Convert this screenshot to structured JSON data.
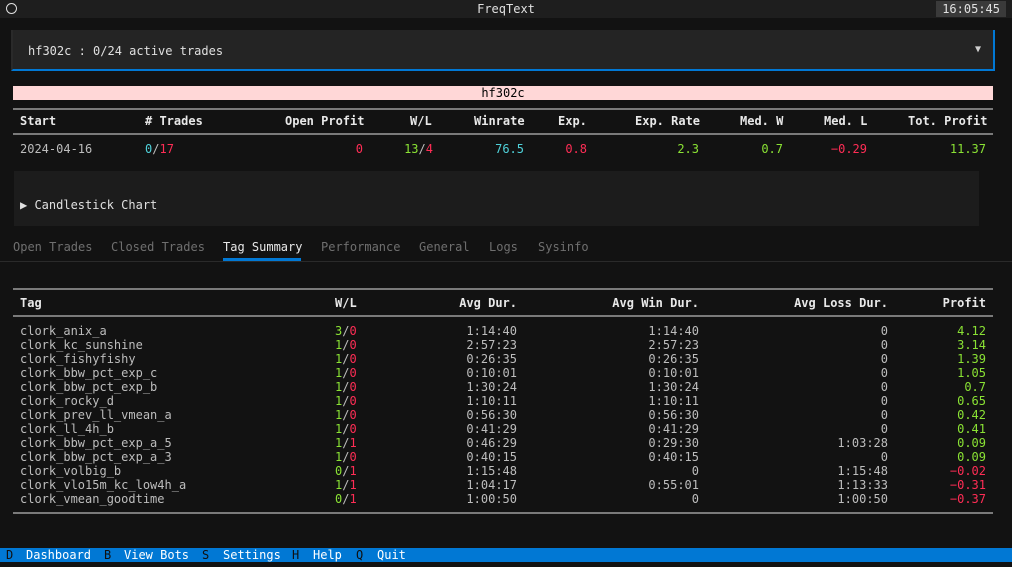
{
  "window": {
    "title": "FreqText",
    "clock": "16:05:45"
  },
  "bot_selector": {
    "label": "hf302c : 0/24 active trades"
  },
  "bot_name": "hf302c",
  "summary": {
    "headers": [
      "Start",
      "# Trades",
      "Open Profit",
      "W/L",
      "Winrate",
      "Exp.",
      "Exp. Rate",
      "Med. W",
      "Med. L",
      "Tot. Profit"
    ],
    "row": {
      "start": "2024-04-16",
      "trades_open": "0",
      "trades_sep": "/",
      "trades_total": "17",
      "open_profit": "0",
      "wins": "13",
      "wl_sep": "/",
      "losses": "4",
      "winrate": "76.5",
      "exp": "0.8",
      "exp_rate": "2.3",
      "med_w": "0.7",
      "med_l": "−0.29",
      "tot_profit": "11.37"
    }
  },
  "candlestick": {
    "label": "▶ Candlestick Chart"
  },
  "tabs": [
    {
      "label": "Open Trades",
      "active": false
    },
    {
      "label": "Closed Trades",
      "active": false
    },
    {
      "label": "Tag Summary",
      "active": true
    },
    {
      "label": "Performance",
      "active": false
    },
    {
      "label": "General",
      "active": false
    },
    {
      "label": "Logs",
      "active": false
    },
    {
      "label": "Sysinfo",
      "active": false
    }
  ],
  "tag_summary": {
    "headers": [
      "Tag",
      "W/L",
      "Avg Dur.",
      "Avg Win Dur.",
      "Avg Loss Dur.",
      "Profit"
    ],
    "rows": [
      {
        "tag": "clork_anix_a",
        "w": "3",
        "l": "0",
        "avg": "1:14:40",
        "win": "1:14:40",
        "loss": "0",
        "profit": "4.12"
      },
      {
        "tag": "clork_kc_sunshine",
        "w": "1",
        "l": "0",
        "avg": "2:57:23",
        "win": "2:57:23",
        "loss": "0",
        "profit": "3.14"
      },
      {
        "tag": "clork_fishyfishy",
        "w": "1",
        "l": "0",
        "avg": "0:26:35",
        "win": "0:26:35",
        "loss": "0",
        "profit": "1.39"
      },
      {
        "tag": "clork_bbw_pct_exp_c",
        "w": "1",
        "l": "0",
        "avg": "0:10:01",
        "win": "0:10:01",
        "loss": "0",
        "profit": "1.05"
      },
      {
        "tag": "clork_bbw_pct_exp_b",
        "w": "1",
        "l": "0",
        "avg": "1:30:24",
        "win": "1:30:24",
        "loss": "0",
        "profit": "0.7"
      },
      {
        "tag": "clork_rocky_d",
        "w": "1",
        "l": "0",
        "avg": "1:10:11",
        "win": "1:10:11",
        "loss": "0",
        "profit": "0.65"
      },
      {
        "tag": "clork_prev_ll_vmean_a",
        "w": "1",
        "l": "0",
        "avg": "0:56:30",
        "win": "0:56:30",
        "loss": "0",
        "profit": "0.42"
      },
      {
        "tag": "clork_ll_4h_b",
        "w": "1",
        "l": "0",
        "avg": "0:41:29",
        "win": "0:41:29",
        "loss": "0",
        "profit": "0.41"
      },
      {
        "tag": "clork_bbw_pct_exp_a_5",
        "w": "1",
        "l": "1",
        "avg": "0:46:29",
        "win": "0:29:30",
        "loss": "1:03:28",
        "profit": "0.09"
      },
      {
        "tag": "clork_bbw_pct_exp_a_3",
        "w": "1",
        "l": "0",
        "avg": "0:40:15",
        "win": "0:40:15",
        "loss": "0",
        "profit": "0.09"
      },
      {
        "tag": "clork_volbig_b",
        "w": "0",
        "l": "1",
        "avg": "1:15:48",
        "win": "0",
        "loss": "1:15:48",
        "profit": "−0.02"
      },
      {
        "tag": "clork_vlo15m_kc_low4h_a",
        "w": "1",
        "l": "1",
        "avg": "1:04:17",
        "win": "0:55:01",
        "loss": "1:13:33",
        "profit": "−0.31"
      },
      {
        "tag": "clork_vmean_goodtime",
        "w": "0",
        "l": "1",
        "avg": "1:00:50",
        "win": "0",
        "loss": "1:00:50",
        "profit": "−0.37"
      }
    ]
  },
  "footer": [
    {
      "key": "D",
      "label": "Dashboard"
    },
    {
      "key": "B",
      "label": "View Bots"
    },
    {
      "key": "S",
      "label": "Settings"
    },
    {
      "key": "H",
      "label": "Help"
    },
    {
      "key": "Q",
      "label": "Quit"
    }
  ],
  "colors": {
    "accent": "#0178d4",
    "positive": "#8ae234",
    "negative": "#ff2d55",
    "winrate": "#4fd1d9",
    "bot_bar": "#ffd7d7"
  }
}
